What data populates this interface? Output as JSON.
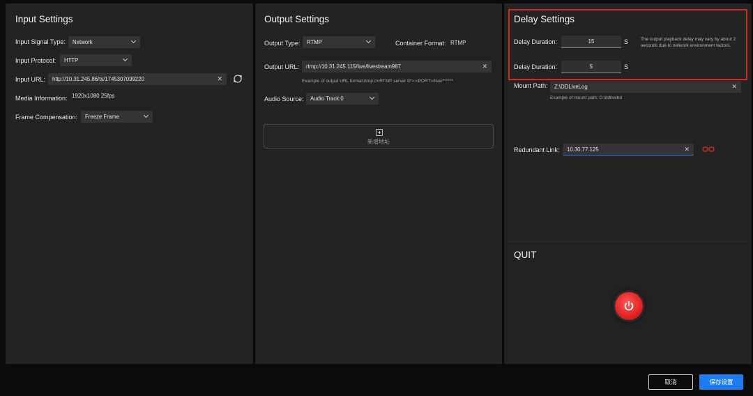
{
  "input": {
    "title": "Input Settings",
    "signal_type_label": "Input Signal Type:",
    "signal_type_value": "Network",
    "protocol_label": "Input Protocol:",
    "protocol_value": "HTTP",
    "url_label": "Input URL:",
    "url_value": "http://10.31.245.86/ts/1745307099220",
    "media_info_label": "Media Information:",
    "media_info_value": "1920x1080 25fps",
    "frame_comp_label": "Frame Compensation:",
    "frame_comp_value": "Freeze Frame"
  },
  "output": {
    "title": "Output Settings",
    "type_label": "Output Type:",
    "type_value": "RTMP",
    "container_label": "Container Format:",
    "container_value": "RTMP",
    "url_label": "Output URL:",
    "url_value": "rtmp://10.31.245.115/live/livestream987",
    "url_hint": "Example of output URL format:rtmp://<RTMP server IP>:<PORT>/live/******",
    "audio_label": "Audio Source:",
    "audio_value": "Audio Track:0",
    "add_label": "新增地址"
  },
  "delay": {
    "title": "Delay Settings",
    "duration1_label": "Delay Duration:",
    "duration1_value": "15",
    "duration1_unit": "S",
    "note": "The output playback delay may vary by about 2 seconds due to network environment factors.",
    "duration2_label": "Delay Duration:",
    "duration2_value": "5",
    "duration2_unit": "S",
    "mount_label": "Mount Path:",
    "mount_value": "Z:\\DDLiveLog",
    "mount_hint": "Example of mount path: D:/ddlivehd",
    "redundant_label": "Redundant Link:",
    "redundant_value": "10.30.77.125"
  },
  "quit": {
    "title": "QUIT"
  },
  "footer": {
    "cancel_label": "取消",
    "save_label": "保存设置"
  },
  "colors": {
    "accent": "#1e7cf2",
    "highlight": "#d22b1c",
    "power": "#e22222",
    "link_broken": "#d93025"
  },
  "icons": {
    "clear": "close-icon",
    "refresh": "refresh-icon",
    "add": "add-square-icon",
    "link": "broken-link-icon",
    "power": "power-icon"
  }
}
